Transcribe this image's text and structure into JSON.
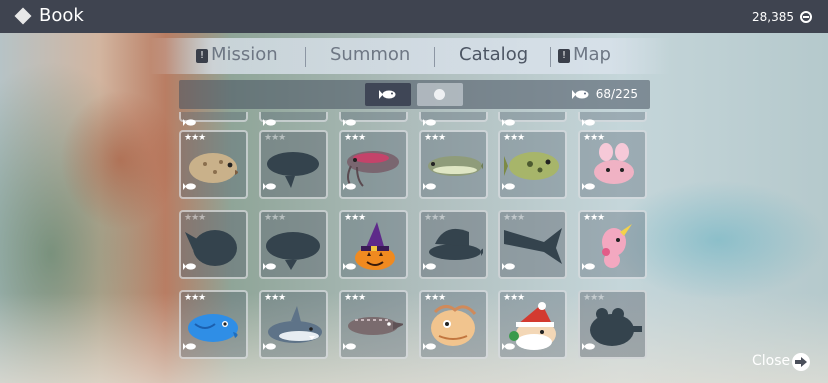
{
  "header": {
    "title": "Book",
    "coins": "28,385"
  },
  "tabs": [
    {
      "label": "Mission",
      "alert": true,
      "active": false
    },
    {
      "label": "Summon",
      "alert": false,
      "active": false
    },
    {
      "label": "Catalog",
      "alert": false,
      "active": true
    },
    {
      "label": "Map",
      "alert": true,
      "active": false
    }
  ],
  "toolbar": {
    "count": "68/225",
    "filters": [
      "fish-filter",
      "other-filter"
    ],
    "selected": "fish-filter"
  },
  "grid": [
    {
      "stars": 3,
      "discovered": true,
      "art": "grouper",
      "color": "#c9b18a"
    },
    {
      "stars": 3,
      "discovered": false,
      "art": "silhouette-dolphin",
      "color": "#3b4a55"
    },
    {
      "stars": 3,
      "discovered": true,
      "art": "catfish",
      "color": "#7a6670"
    },
    {
      "stars": 3,
      "discovered": true,
      "art": "pike",
      "color": "#8f9c7a"
    },
    {
      "stars": 3,
      "discovered": true,
      "art": "bass",
      "color": "#a7b56a"
    },
    {
      "stars": 3,
      "discovered": true,
      "art": "axolotl",
      "color": "#f0b2c4"
    },
    {
      "stars": 3,
      "discovered": false,
      "art": "silhouette-puffer",
      "color": "#3b4a55"
    },
    {
      "stars": 3,
      "discovered": false,
      "art": "silhouette-whale",
      "color": "#3b4a55"
    },
    {
      "stars": 3,
      "discovered": true,
      "art": "pumpkin-fish",
      "color": "#f08a20"
    },
    {
      "stars": 3,
      "discovered": false,
      "art": "silhouette-sailfish",
      "color": "#3b4a55"
    },
    {
      "stars": 3,
      "discovered": false,
      "art": "silhouette-marlin",
      "color": "#3b4a55"
    },
    {
      "stars": 3,
      "discovered": true,
      "art": "seahorse",
      "color": "#f3a8c0"
    },
    {
      "stars": 3,
      "discovered": true,
      "art": "parrotfish",
      "color": "#2f8ee6"
    },
    {
      "stars": 3,
      "discovered": true,
      "art": "shark",
      "color": "#5e7388"
    },
    {
      "stars": 3,
      "discovered": true,
      "art": "sturgeon",
      "color": "#7a6b6e"
    },
    {
      "stars": 3,
      "discovered": true,
      "art": "scorpionfish",
      "color": "#f1c48e"
    },
    {
      "stars": 3,
      "discovered": true,
      "art": "santa-fish",
      "color": "#d33a30"
    },
    {
      "stars": 3,
      "discovered": false,
      "art": "silhouette-frog",
      "color": "#3b4a55"
    }
  ],
  "footer": {
    "close_label": "Close"
  }
}
